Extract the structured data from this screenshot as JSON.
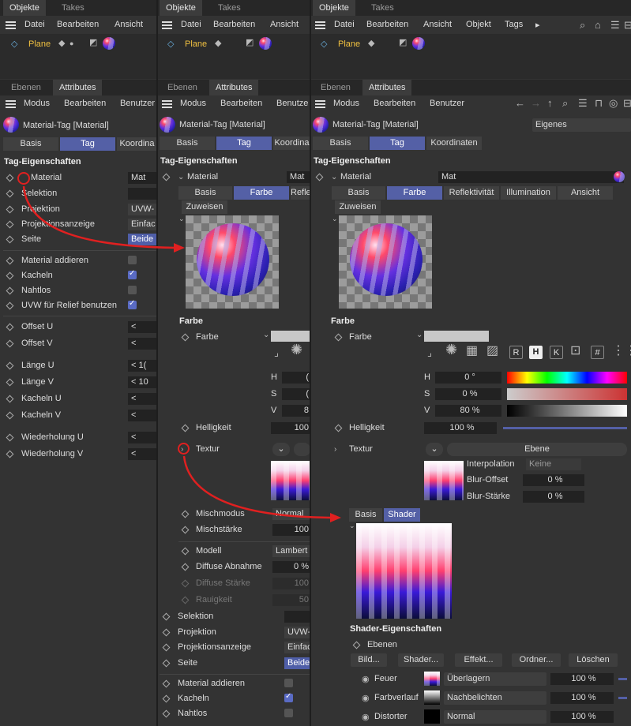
{
  "tabs": {
    "objekte": "Objekte",
    "takes": "Takes",
    "ebenen": "Ebenen",
    "attributes": "Attributes"
  },
  "objmenu": {
    "datei": "Datei",
    "bearbeiten": "Bearbeiten",
    "ansicht": "Ansicht",
    "objekt": "Objekt",
    "tags": "Tags",
    "more": "▸"
  },
  "object_name": "Plane",
  "attrmenu": {
    "modus": "Modus",
    "bearbeiten": "Bearbeiten",
    "benutzer": "Benutzer",
    "benutze_short": "Benutze"
  },
  "header": {
    "title": "Material-Tag [Material]",
    "mode": "Eigenes"
  },
  "subtabs": {
    "basis": "Basis",
    "tag": "Tag",
    "koordinaten": "Koordinaten",
    "koordina_short": "Koordina"
  },
  "section_title": "Tag-Eigenschaften",
  "pane1": {
    "rows": [
      {
        "label": "Material",
        "value": "Mat"
      },
      {
        "label": "Selektion",
        "value": ""
      },
      {
        "label": "Projektion",
        "value": "UVW-"
      },
      {
        "label": "Projektionsanzeige",
        "value": "Einfac"
      },
      {
        "label": "Seite",
        "value": "Beide"
      }
    ],
    "checks": [
      {
        "label": "Material addieren"
      },
      {
        "label": "Kacheln"
      },
      {
        "label": "Nahtlos"
      },
      {
        "label": "UVW für Relief benutzen"
      }
    ],
    "nums": [
      {
        "label": "Offset U",
        "value": "<"
      },
      {
        "label": "Offset V",
        "value": "<"
      },
      {
        "label": "Länge U",
        "value": "< 1("
      },
      {
        "label": "Länge V",
        "value": "< 10"
      },
      {
        "label": "Kacheln U",
        "value": "<"
      },
      {
        "label": "Kacheln V",
        "value": "<"
      },
      {
        "label": "Wiederholung U",
        "value": "<"
      },
      {
        "label": "Wiederholung V",
        "value": "<"
      }
    ]
  },
  "mattabs": {
    "basis": "Basis",
    "farbe": "Farbe",
    "reflektivitaet": "Reflektivität",
    "refle_short": "Refle",
    "illumination": "Illumination",
    "ansicht": "Ansicht",
    "zuweisen": "Zuweisen"
  },
  "farbe": {
    "title": "Farbe",
    "label": "Farbe",
    "h": "H",
    "s": "S",
    "v": "V",
    "h_value": "0 °",
    "s_value": "0 %",
    "v_value": "80 %",
    "s_short": "(",
    "v_short": "8",
    "helligkeit": "Helligkeit",
    "helligkeit_value": "100 %",
    "helligkeit_short": "100",
    "textur": "Textur",
    "ebene": "Ebene",
    "mode_buttons": [
      "R",
      "H",
      "K",
      "#"
    ]
  },
  "interp": {
    "interpolation": "Interpolation",
    "interpolation_value": "Keine",
    "blur_offset": "Blur-Offset",
    "blur_offset_value": "0 %",
    "blur_staerke": "Blur-Stärke",
    "blur_staerke_value": "0 %"
  },
  "pane2_lower": [
    {
      "label": "Mischmodus",
      "value": "Normal"
    },
    {
      "label": "Mischstärke",
      "value": "100"
    },
    {
      "label": "Modell",
      "value": "Lambert"
    },
    {
      "label": "Diffuse Abnahme",
      "value": "0 %"
    },
    {
      "label": "Diffuse Stärke",
      "value": "100"
    },
    {
      "label": "Rauigkeit",
      "value": "50"
    },
    {
      "label": "Selektion",
      "value": ""
    },
    {
      "label": "Projektion",
      "value": "UVW-"
    },
    {
      "label": "Projektionsanzeige",
      "value": "Einfac"
    },
    {
      "label": "Seite",
      "value": "Beide"
    },
    {
      "label": "Material addieren",
      "value": ""
    },
    {
      "label": "Kacheln",
      "value": ""
    },
    {
      "label": "Nahtlos",
      "value": ""
    }
  ],
  "shader": {
    "basis": "Basis",
    "shader": "Shader",
    "title": "Shader-Eigenschaften",
    "ebenen": "Ebenen",
    "buttons": [
      "Bild...",
      "Shader...",
      "Effekt...",
      "Ordner...",
      "Löschen"
    ],
    "layers": [
      {
        "name": "Feuer",
        "mode": "Überlagern",
        "value": "100 %"
      },
      {
        "name": "Farbverlauf",
        "mode": "Nachbelichten",
        "value": "100 %"
      },
      {
        "name": "Distorter",
        "mode": "Normal",
        "value": "100 %"
      }
    ]
  },
  "colors": {
    "accent": "#5460a6",
    "arrow": "#e02020"
  }
}
